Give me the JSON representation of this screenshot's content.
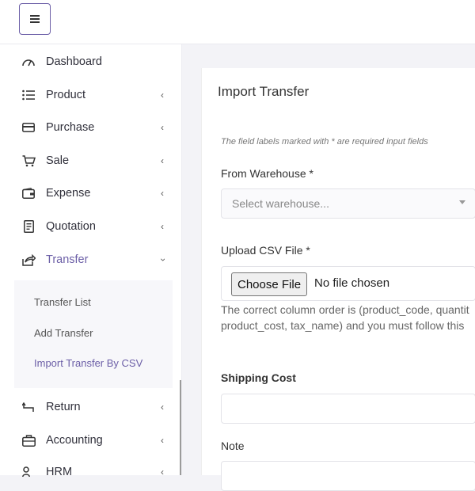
{
  "header": {
    "menu_icon": "hamburger-icon"
  },
  "sidebar": {
    "items": [
      {
        "label": "Dashboard",
        "icon": "gauge-icon",
        "has_children": false
      },
      {
        "label": "Product",
        "icon": "list-icon",
        "has_children": true
      },
      {
        "label": "Purchase",
        "icon": "card-icon",
        "has_children": true
      },
      {
        "label": "Sale",
        "icon": "cart-icon",
        "has_children": true
      },
      {
        "label": "Expense",
        "icon": "wallet-icon",
        "has_children": true
      },
      {
        "label": "Quotation",
        "icon": "document-icon",
        "has_children": true
      },
      {
        "label": "Transfer",
        "icon": "share-icon",
        "has_children": true,
        "expanded": true
      },
      {
        "label": "Return",
        "icon": "return-icon",
        "has_children": true
      },
      {
        "label": "Accounting",
        "icon": "briefcase-icon",
        "has_children": true
      },
      {
        "label": "HRM",
        "icon": "users-icon",
        "has_children": true
      }
    ],
    "transfer_submenu": [
      {
        "label": "Transfer List"
      },
      {
        "label": "Add Transfer"
      },
      {
        "label": "Import Transfer By CSV",
        "active": true
      }
    ]
  },
  "main": {
    "title": "Import Transfer",
    "required_hint": "The field labels marked with * are required input fields",
    "from_warehouse": {
      "label": "From Warehouse *",
      "placeholder": "Select warehouse..."
    },
    "upload": {
      "label": "Upload CSV File *",
      "button_label": "Choose File",
      "status": "No file chosen"
    },
    "help_line1": "The correct column order is (product_code, quantit",
    "help_line2": "product_cost, tax_name) and you must follow this",
    "shipping": {
      "label": "Shipping Cost",
      "value": ""
    },
    "note": {
      "label": "Note",
      "value": ""
    }
  },
  "colors": {
    "accent": "#6c5fa7",
    "text": "#333333",
    "muted": "#777777"
  }
}
